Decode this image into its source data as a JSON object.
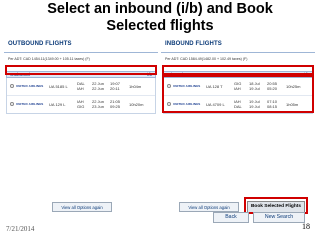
{
  "slide": {
    "title_line1": "Select an inbound (i/b) and Book",
    "title_line2": "Selected flights",
    "date": "7/21/2014",
    "page_number": "18"
  },
  "outbound": {
    "header": "OUTBOUND FLIGHTS",
    "fare": "Per ADT: CAD 1454.11(1349.00 + 105.11 taxes) (F)",
    "redline": "",
    "direction_label": "Outbound",
    "direction_right": "i/b",
    "flights": [
      {
        "logo": "UNITED AIRLINES",
        "flight": "UA 5185 L",
        "from": "DAL",
        "to": "IAH",
        "dep_date": "22 Jun",
        "arr_date": "22 Jun",
        "dep_time": "19:07",
        "arr_time": "20:11",
        "duration": "1h04m"
      },
      {
        "logo": "UNITED AIRLINES",
        "flight": "UA 129 L",
        "from": "IAH",
        "to": "GIG",
        "dep_date": "22 Jun",
        "arr_date": "23 Jun",
        "dep_time": "21:05",
        "arr_time": "09:25",
        "duration": "10h20m"
      }
    ],
    "view_options_label": "View all Options again"
  },
  "inbound": {
    "header": "INBOUND FLIGHTS",
    "fare": "Per ADT: CAD 1584.49(1482.00 + 102.49 taxes) (F)",
    "redline": "",
    "direction_label": "Inbound",
    "direction_right": "i/b",
    "flights": [
      {
        "logo": "UNITED AIRLINES",
        "flight": "UA 128 T",
        "from": "GIG",
        "to": "IAH",
        "dep_date": "18 Jul",
        "arr_date": "19 Jul",
        "dep_time": "20:55",
        "arr_time": "05:20",
        "duration": "10h25m"
      },
      {
        "logo": "UNITED AIRLINES",
        "flight": "UA 4709 L",
        "from": "IAH",
        "to": "DAL",
        "dep_date": "19 Jul",
        "arr_date": "19 Jul",
        "dep_time": "07:10",
        "arr_time": "08:15",
        "duration": "1h05m"
      }
    ],
    "view_options_label": "View all Options again",
    "book_label": "Book Selected Flights"
  },
  "nav": {
    "back_label": "Back",
    "new_search_label": "New Search"
  },
  "colors": {
    "highlight": "#d00000",
    "header_text": "#0b3a78"
  }
}
